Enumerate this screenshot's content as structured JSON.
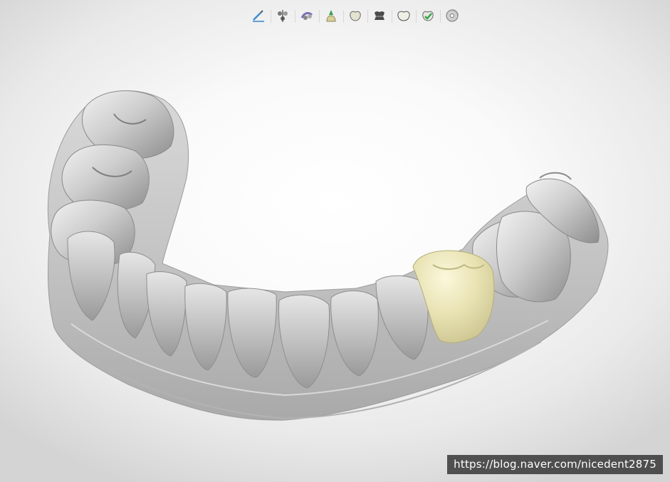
{
  "toolbar": {
    "tools": [
      {
        "icon": "margin-line-pencil-icon"
      },
      {
        "icon": "insertion-axis-icon"
      },
      {
        "icon": "tooth-position-icon"
      },
      {
        "icon": "cement-gap-icon"
      },
      {
        "icon": "crown-outline-icon"
      },
      {
        "icon": "anatomy-dark-crown-icon"
      },
      {
        "icon": "crown-shape-icon"
      },
      {
        "icon": "crown-check-icon"
      },
      {
        "icon": "save-disc-icon"
      }
    ]
  },
  "scene": {
    "model": "lower-jaw-scan",
    "restoration": "crown",
    "colors": {
      "gum_model": "#c8c8c8",
      "crown": "#e9e4b6",
      "background": "#ffffff"
    }
  },
  "watermark": {
    "text": "https://blog.naver.com/nicedent2875"
  }
}
